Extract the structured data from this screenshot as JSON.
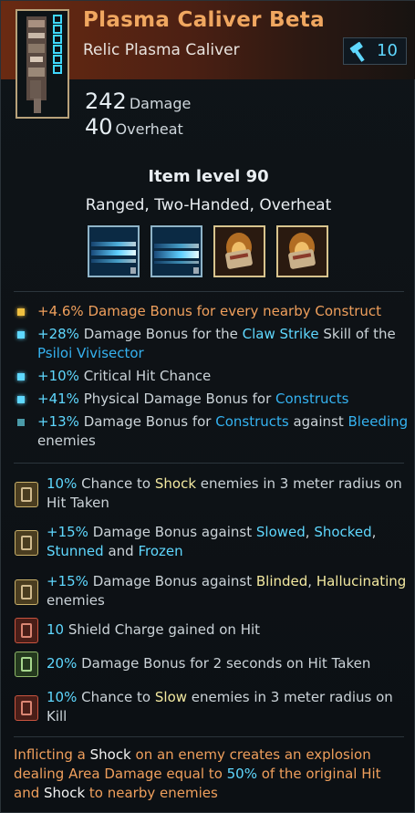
{
  "item": {
    "name": "Plasma Caliver Beta",
    "type": "Relic Plasma Caliver",
    "level_requirement": "10",
    "damage_value": "242",
    "damage_label": "Damage",
    "overheat_value": "40",
    "overheat_label": "Overheat",
    "item_level": "Item level 90",
    "tags": "Ranged, Two-Handed, Overheat"
  },
  "slots": [
    {
      "kind": "blue-beam-icon"
    },
    {
      "kind": "blue-beam-icon"
    },
    {
      "kind": "flaming-scroll-icon"
    },
    {
      "kind": "flaming-scroll-icon"
    }
  ],
  "colors": {
    "title": "#f0a760",
    "highlight_cyan": "#5fd8ff",
    "highlight_blue": "#35b2f0",
    "highlight_orange": "#ef9f5c",
    "highlight_yellow": "#f3e9a0",
    "bullet_gold": "#f0c040"
  },
  "mods": [
    {
      "parts": [
        [
          "+4.6%",
          "o"
        ],
        [
          " Damage Bonus for every nearby Construct",
          "o"
        ]
      ]
    },
    {
      "parts": [
        [
          "+28%",
          "c"
        ],
        [
          " Damage Bonus for the ",
          "d"
        ],
        [
          "Claw Strike",
          "c"
        ],
        [
          " Skill of the ",
          "d"
        ],
        [
          "Psiloi Vivisector",
          "b"
        ]
      ]
    },
    {
      "parts": [
        [
          "+10%",
          "c"
        ],
        [
          " Critical Hit Chance",
          "d"
        ]
      ]
    },
    {
      "parts": [
        [
          "+41%",
          "c"
        ],
        [
          " Physical Damage Bonus for ",
          "d"
        ],
        [
          "Constructs",
          "b"
        ]
      ]
    },
    {
      "parts": [
        [
          "+13%",
          "c"
        ],
        [
          " Damage Bonus for ",
          "d"
        ],
        [
          "Constructs",
          "b"
        ],
        [
          " against ",
          "d"
        ],
        [
          "Bleeding",
          "b"
        ],
        [
          " enemies",
          "d"
        ]
      ]
    }
  ],
  "perks": [
    {
      "icon": "gold-tablet-icon",
      "parts": [
        [
          "10%",
          "c"
        ],
        [
          " Chance to ",
          "d"
        ],
        [
          "Shock",
          "y"
        ],
        [
          " enemies in 3 meter radius on Hit Taken",
          "d"
        ]
      ]
    },
    {
      "icon": "gold-tablet-icon",
      "parts": [
        [
          "+15%",
          "c"
        ],
        [
          " Damage Bonus against ",
          "d"
        ],
        [
          "Slowed",
          "c"
        ],
        [
          ", ",
          "d"
        ],
        [
          "Shocked",
          "c"
        ],
        [
          ", ",
          "d"
        ],
        [
          "Stunned",
          "c"
        ],
        [
          " and ",
          "d"
        ],
        [
          "Frozen",
          "c"
        ]
      ]
    },
    {
      "icon": "gold-tablet-icon",
      "parts": [
        [
          "+15%",
          "c"
        ],
        [
          " Damage Bonus against ",
          "d"
        ],
        [
          "Blinded",
          "y"
        ],
        [
          ", ",
          "d"
        ],
        [
          "Hallucinating",
          "y"
        ],
        [
          " enemies",
          "d"
        ]
      ]
    },
    {
      "icon": "red-tablet-icon",
      "parts": [
        [
          "10",
          "c"
        ],
        [
          " Shield Charge gained on Hit",
          "d"
        ]
      ]
    },
    {
      "icon": "green-tablet-icon",
      "parts": [
        [
          "20%",
          "c"
        ],
        [
          " Damage Bonus for 2 seconds on Hit Taken",
          "d"
        ]
      ]
    },
    {
      "icon": "red-tablet-icon",
      "parts": [
        [
          "10%",
          "c"
        ],
        [
          " Chance to ",
          "d"
        ],
        [
          "Slow",
          "y"
        ],
        [
          " enemies in 3 meter radius on Kill",
          "d"
        ]
      ]
    }
  ],
  "description": {
    "parts": [
      [
        "Inflicting a ",
        "o"
      ],
      [
        "Shock",
        "w"
      ],
      [
        " on an enemy creates an explosion dealing Area Damage equal to ",
        "o"
      ],
      [
        "50%",
        "c"
      ],
      [
        " of the original Hit and ",
        "o"
      ],
      [
        "Shock",
        "w"
      ],
      [
        " to nearby enemies",
        "o"
      ]
    ]
  }
}
